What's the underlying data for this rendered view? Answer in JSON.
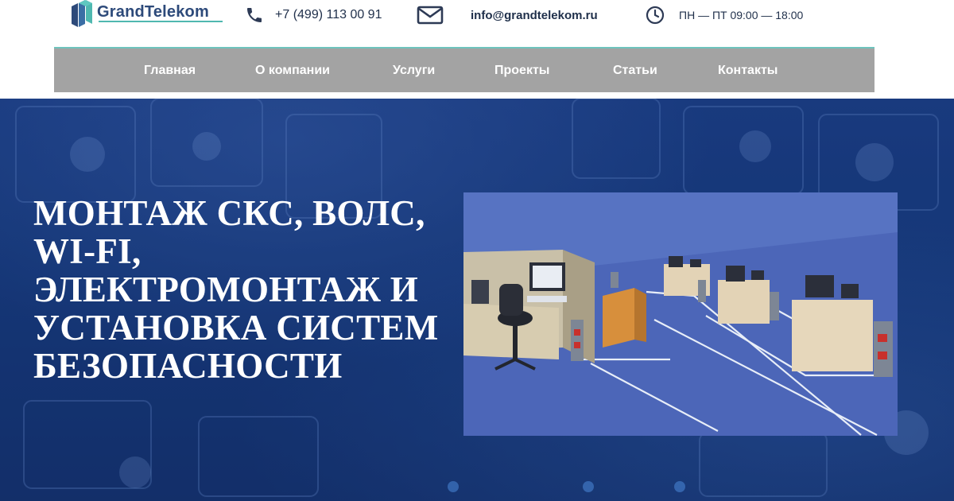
{
  "brand": {
    "name": "GrandTelekom",
    "colors": {
      "primary": "#2d4a7a",
      "accent": "#4fb8b0",
      "nav_bg": "#a3a3a3",
      "hero_bg": "#1c3f86"
    }
  },
  "header": {
    "phone": {
      "icon": "phone-icon",
      "text": "+7 (499) 113 00 91"
    },
    "email": {
      "icon": "mail-icon",
      "text": "info@grandtelekom.ru"
    },
    "hours": {
      "icon": "clock-icon",
      "text": "ПН — ПТ 09:00 — 18:00"
    }
  },
  "nav": {
    "items": [
      {
        "label": "Главная"
      },
      {
        "label": "О компании"
      },
      {
        "label": "Услуги"
      },
      {
        "label": "Проекты"
      },
      {
        "label": "Статьи"
      },
      {
        "label": "Контакты"
      }
    ]
  },
  "hero": {
    "title": "МОНТАЖ СКС, ВОЛС,\nWI-FI,\nЭЛЕКТРОМОНТАЖ И\nУСТАНОВКА СИСТЕМ\nБЕЗОПАСНОСТИ"
  }
}
